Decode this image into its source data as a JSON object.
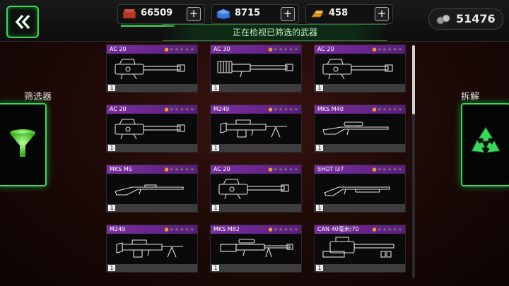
{
  "header": {
    "back_icon": "double-chevron-left-icon",
    "resources": [
      {
        "icon": "brick-resource-icon",
        "value": "66509",
        "plus": "+",
        "color": "#b23a2a"
      },
      {
        "icon": "blue-crate-resource-icon",
        "value": "8715",
        "plus": "+",
        "color": "#3a7ad8"
      },
      {
        "icon": "gold-bar-resource-icon",
        "value": "458",
        "plus": "+",
        "color": "#e8a020"
      }
    ],
    "subtitle": "正在检视已筛选的武器",
    "currency_value": "51476",
    "currency_icon": "coins-icon"
  },
  "left_panel": {
    "label": "筛选器",
    "icon": "funnel-icon"
  },
  "right_panel": {
    "label": "拆解",
    "icon": "recycle-icon"
  },
  "accent_color": "#3ad85a",
  "weapons": [
    {
      "name": "AC 20",
      "stars": 1,
      "count": "1",
      "gun": "ac20"
    },
    {
      "name": "AC 30",
      "stars": 1,
      "count": "1",
      "gun": "ac30"
    },
    {
      "name": "AC 20",
      "stars": 1,
      "count": "1",
      "gun": "ac20"
    },
    {
      "name": "AC 20",
      "stars": 1,
      "count": "1",
      "gun": "ac20"
    },
    {
      "name": "M249",
      "stars": 1,
      "count": "1",
      "gun": "m249"
    },
    {
      "name": "MKS M40",
      "stars": 1,
      "count": "1",
      "gun": "sniper"
    },
    {
      "name": "MKS MS",
      "stars": 1,
      "count": "1",
      "gun": "rifle"
    },
    {
      "name": "AC 20",
      "stars": 1,
      "count": "1",
      "gun": "ac20"
    },
    {
      "name": "SHOT I37",
      "stars": 1,
      "count": "1",
      "gun": "shotgun"
    },
    {
      "name": "M249",
      "stars": 1,
      "count": "1",
      "gun": "m249"
    },
    {
      "name": "MKS M82",
      "stars": 1,
      "count": "1",
      "gun": "m82"
    },
    {
      "name": "CAN 40毫米/70",
      "stars": 1,
      "count": "1",
      "gun": "cannon"
    }
  ]
}
